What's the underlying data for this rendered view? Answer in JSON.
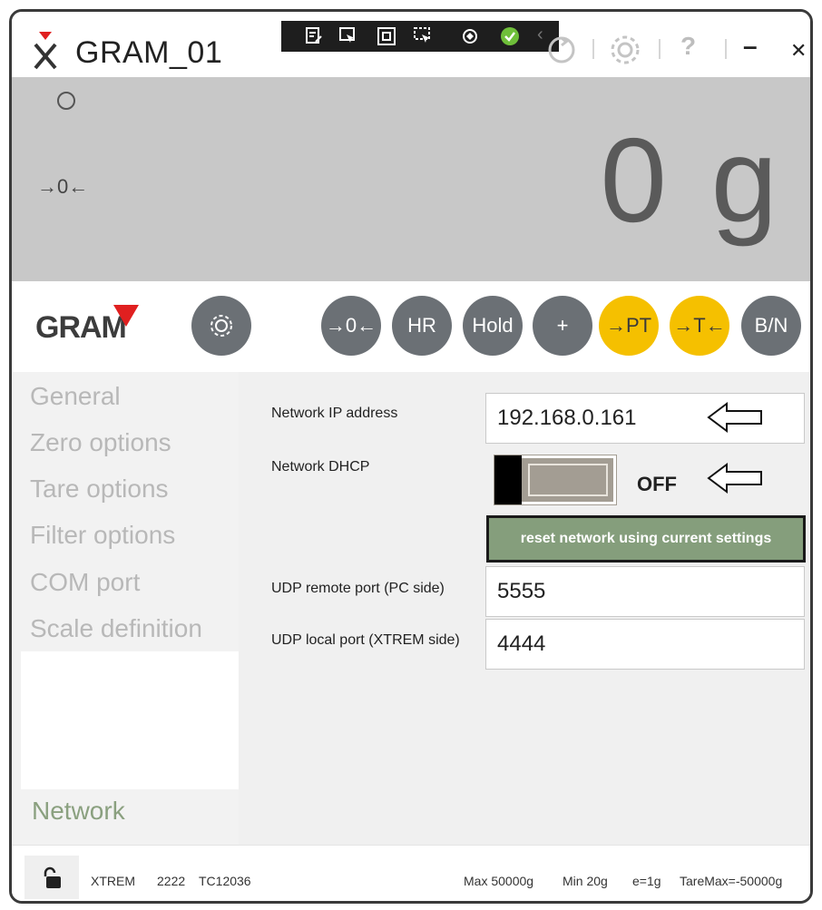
{
  "window": {
    "title": "GRAM_01",
    "controls": {
      "minimize": "–",
      "close": "✕",
      "help": "?"
    }
  },
  "display": {
    "weight": "0 g",
    "zero_indicator": "→0←"
  },
  "brand": {
    "logo_text": "GRAM",
    "accent_color": "#e02020"
  },
  "scale_buttons": [
    {
      "label": "→0←",
      "color": "#6b7075"
    },
    {
      "label": "HR",
      "color": "#6b7075"
    },
    {
      "label": "Hold",
      "color": "#6b7075"
    },
    {
      "label": "+",
      "color": "#6b7075"
    },
    {
      "label": "→PT",
      "color": "#f5c000"
    },
    {
      "label": "→T←",
      "color": "#f5c000"
    },
    {
      "label": "B/N",
      "color": "#6b7075"
    }
  ],
  "sidebar": {
    "items": [
      {
        "label": "General"
      },
      {
        "label": "Zero options"
      },
      {
        "label": "Tare options"
      },
      {
        "label": "Filter options"
      },
      {
        "label": "COM port"
      },
      {
        "label": "Scale definition"
      }
    ],
    "active": {
      "label": "Network"
    }
  },
  "network": {
    "ip_label": "Network IP address",
    "ip_value": "192.168.0.161",
    "dhcp_label": "Network DHCP",
    "dhcp_state": "OFF",
    "reset_button": "reset network using current settings",
    "udp_remote_label": "UDP remote port (PC side)",
    "udp_remote_value": "5555",
    "udp_local_label": "UDP local port (XTREM side)",
    "udp_local_value": "4444"
  },
  "status_bar": {
    "model": "XTREM",
    "id": "2222",
    "code": "TC12036",
    "max": "Max 50000g",
    "min": "Min 20g",
    "e": "e=1g",
    "tare_max": "TareMax=-50000g"
  }
}
